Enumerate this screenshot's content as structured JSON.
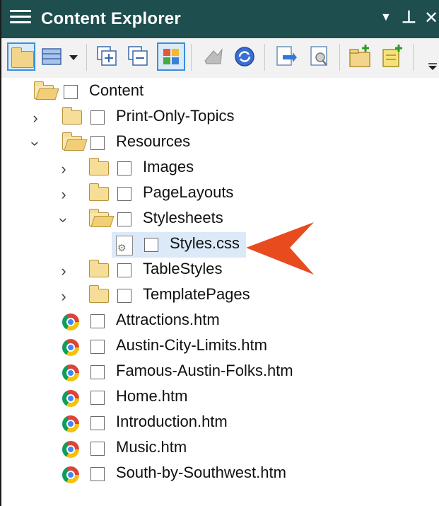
{
  "panel": {
    "title": "Content Explorer",
    "colors": {
      "titlebar": "#1f4e4f",
      "selection": "#dbe9f8",
      "arrow": "#e84b1e"
    },
    "titlebar_icons": [
      "hamburger-menu-icon",
      "dropdown-arrow-icon",
      "pin-icon",
      "close-icon"
    ]
  },
  "toolbar": {
    "icons": [
      "folder-icon",
      "table-view-icon",
      "dropdown-icon",
      "expand-all-icon",
      "collapse-all-icon",
      "grid-view-icon",
      "send-icon",
      "refresh-icon",
      "open-file-icon",
      "properties-icon",
      "new-folder-icon",
      "new-file-icon"
    ]
  },
  "tree": {
    "root": "Content",
    "items": [
      {
        "label": "Print-Only-Topics",
        "type": "folder",
        "expanded": false
      },
      {
        "label": "Resources",
        "type": "folder",
        "expanded": true
      },
      {
        "label": "Images",
        "type": "folder",
        "expanded": false
      },
      {
        "label": "PageLayouts",
        "type": "folder",
        "expanded": false
      },
      {
        "label": "Stylesheets",
        "type": "folder",
        "expanded": true
      },
      {
        "label": "Styles.css",
        "type": "stylesheet",
        "selected": true
      },
      {
        "label": "TableStyles",
        "type": "folder",
        "expanded": false
      },
      {
        "label": "TemplatePages",
        "type": "folder",
        "expanded": false
      },
      {
        "label": "Attractions.htm",
        "type": "htm"
      },
      {
        "label": "Austin-City-Limits.htm",
        "type": "htm"
      },
      {
        "label": "Famous-Austin-Folks.htm",
        "type": "htm"
      },
      {
        "label": "Home.htm",
        "type": "htm"
      },
      {
        "label": "Introduction.htm",
        "type": "htm"
      },
      {
        "label": "Music.htm",
        "type": "htm"
      },
      {
        "label": "South-by-Southwest.htm",
        "type": "htm"
      }
    ]
  }
}
